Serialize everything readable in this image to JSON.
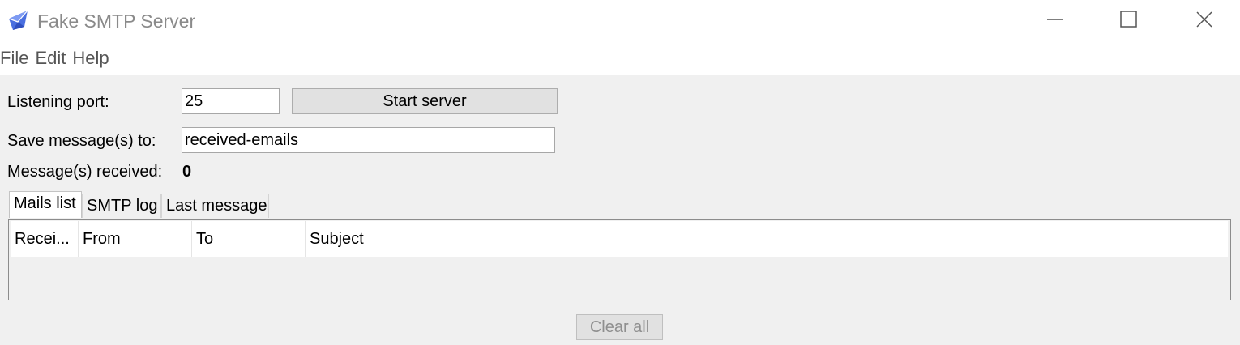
{
  "window": {
    "title": "Fake SMTP Server",
    "icon": "envelope-icon",
    "controls": {
      "minimize": "minimize-icon",
      "maximize": "maximize-icon",
      "close": "close-icon"
    }
  },
  "menu": {
    "items": [
      "File",
      "Edit",
      "Help"
    ]
  },
  "form": {
    "port_label": "Listening port:",
    "port_value": "25",
    "start_button": "Start server",
    "save_label": "Save message(s) to:",
    "save_value": "received-emails",
    "received_label": "Message(s) received:",
    "received_count": "0"
  },
  "tabs": [
    "Mails list",
    "SMTP log",
    "Last message"
  ],
  "active_tab": "Mails list",
  "table": {
    "columns": [
      "Recei...",
      "From",
      "To",
      "Subject"
    ],
    "rows": []
  },
  "footer": {
    "clear_button": "Clear all"
  },
  "colors": {
    "accent": "#3b5bdb",
    "window_bg": "#f0f0f0"
  }
}
